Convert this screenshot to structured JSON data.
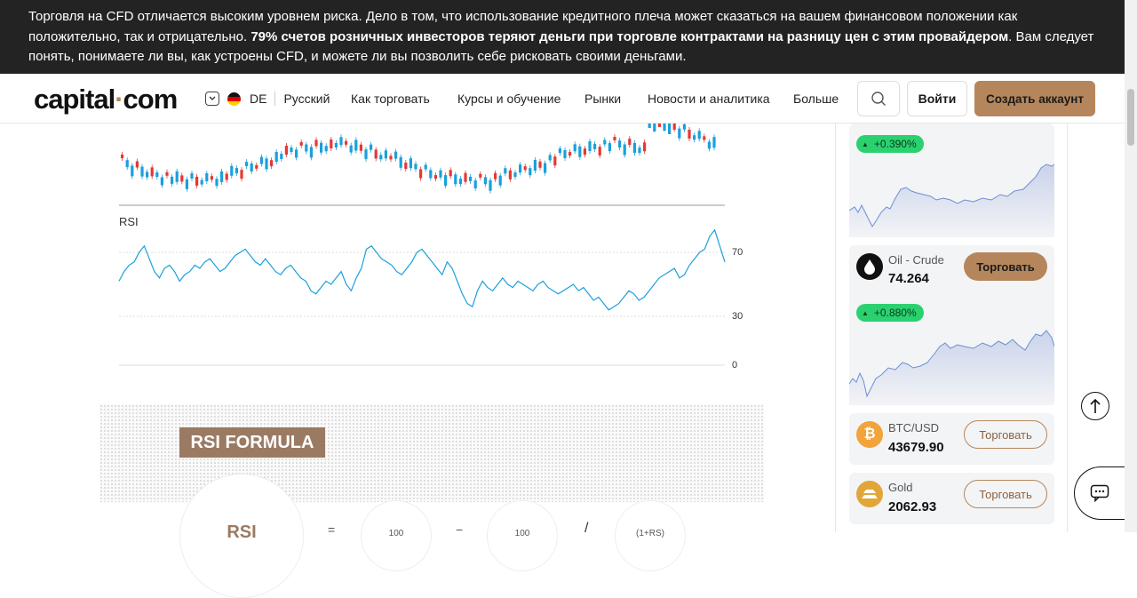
{
  "risk_banner": {
    "text_part1": "Торговля на CFD отличается высоким уровнем риска. Дело в том, что использование кредитного плеча может сказаться на вашем финансовом положении как положительно, так и отрицательно. ",
    "text_bold": "79% счетов розничных инвесторов теряют деньги при торговле контрактами на разницу цен с этим провайдером",
    "text_part2": ". Вам следует понять, понимаете ли вы, как устроены CFD, и можете ли вы позволить себе рисковать своими деньгами."
  },
  "header": {
    "logo_part1": "capital",
    "logo_dot": "·",
    "logo_part2": "com",
    "region_code": "DE",
    "language": "Русский",
    "nav": [
      "Как торговать",
      "Курсы и обучение",
      "Рынки",
      "Новости и аналитика",
      "Больше"
    ],
    "login_label": "Войти",
    "signup_label": "Создать аккаунт",
    "icons": {
      "search": "search-icon",
      "chevron": "chevron-down-icon",
      "flag": "germany-flag-icon"
    }
  },
  "chart": {
    "rsi_label": "RSI",
    "rsi_axis": [
      "70",
      "30",
      "0"
    ]
  },
  "chart_data": {
    "type": "line",
    "title": "",
    "rsi_levels": [
      70,
      30,
      0
    ],
    "ylim": [
      0,
      100
    ],
    "x": [
      0,
      2,
      4,
      6,
      8,
      10,
      12,
      14,
      16,
      18,
      20,
      22,
      24,
      26,
      28,
      30,
      32,
      34,
      36,
      38,
      40,
      42,
      44,
      46,
      48,
      50,
      52,
      54,
      56,
      58,
      60,
      62,
      64,
      66,
      68,
      70,
      72,
      74,
      76,
      78,
      80,
      82,
      84,
      86,
      88,
      90,
      92,
      94,
      96,
      98,
      100,
      102,
      104,
      106,
      108,
      110,
      112,
      114,
      116,
      118,
      120,
      122,
      124,
      126,
      128,
      130,
      132,
      134,
      136,
      138,
      140,
      142,
      144,
      146,
      148,
      150,
      152,
      154,
      156,
      158,
      160,
      162,
      164,
      166,
      168,
      170,
      172,
      174,
      176,
      178,
      180,
      182,
      184,
      186,
      188,
      190,
      192,
      194,
      196,
      198,
      200,
      202,
      204,
      206,
      208,
      210,
      212,
      214,
      216,
      218,
      220,
      222,
      224,
      226,
      228,
      230,
      232,
      234,
      236,
      238,
      240
    ],
    "series": [
      {
        "values": [
          52,
          58,
          62,
          64,
          70,
          74,
          66,
          58,
          54,
          60,
          62,
          58,
          52,
          56,
          58,
          62,
          60,
          64,
          66,
          62,
          58,
          60,
          64,
          68,
          70,
          72,
          68,
          64,
          62,
          66,
          62,
          58,
          56,
          60,
          62,
          58,
          54,
          52,
          46,
          44,
          48,
          52,
          50,
          54,
          58,
          50,
          46,
          54,
          60,
          72,
          74,
          70,
          66,
          64,
          62,
          58,
          56,
          60,
          64,
          70,
          72,
          68,
          64,
          60,
          56,
          64,
          60,
          52,
          44,
          38,
          36,
          46,
          52,
          48,
          46,
          50,
          54,
          50,
          48,
          52,
          50,
          48,
          46,
          50,
          52,
          48,
          46,
          44,
          46,
          48,
          50,
          46,
          48,
          44,
          40,
          42,
          38,
          34,
          36,
          38,
          42,
          46,
          44,
          40,
          42,
          46,
          50,
          54,
          56,
          58,
          60,
          54,
          56,
          62,
          66,
          70,
          72,
          80,
          84,
          74,
          64
        ]
      }
    ]
  },
  "formula": {
    "tag": "RSI FORMULA",
    "circle_rsi": "RSI",
    "eq": "=",
    "num1": "100",
    "minus": "−",
    "num2": "100",
    "slash": "/",
    "denom": "(1+RS)"
  },
  "sidebar": {
    "card0": {
      "change": "+0.390%"
    },
    "card1": {
      "name": "Oil - Crude",
      "price": "74.264",
      "change": "+0.880%",
      "trade": "Торговать",
      "icon": "oil-drop-icon"
    },
    "card2": {
      "name": "BTC/USD",
      "price": "43679.90",
      "trade": "Торговать",
      "icon": "bitcoin-icon"
    },
    "card3": {
      "name": "Gold",
      "price": "2062.93",
      "trade": "Торговать",
      "icon": "gold-bars-icon"
    }
  },
  "colors": {
    "brand": "#b5865b",
    "positive": "#2bd16f",
    "negative": "#e53935",
    "line": "#1aa0dc",
    "banner": "#232323"
  }
}
